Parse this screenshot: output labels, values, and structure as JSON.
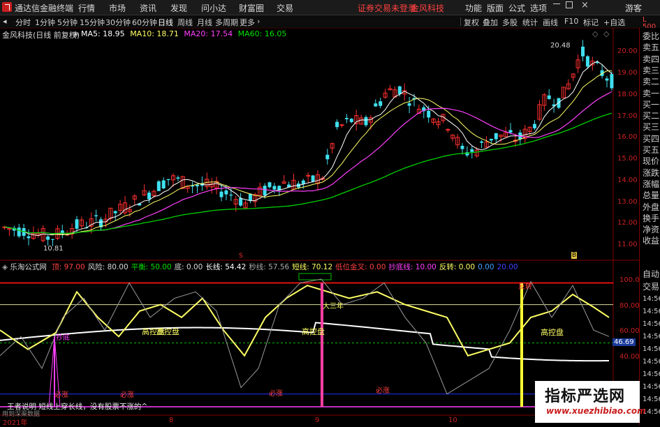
{
  "titlebar": {
    "app_name": "通达信金融终端",
    "menu": [
      "行情",
      "市场",
      "资讯",
      "发现",
      "问小达",
      "财富圈",
      "交易"
    ],
    "notice": "证券交易未登录",
    "stock_name_top": "金风科技",
    "right_menu": [
      "功能",
      "版面",
      "公式",
      "选项"
    ],
    "guest": "游客"
  },
  "toolbar": {
    "periods": [
      "分时",
      "1分钟",
      "5分钟",
      "15分钟",
      "30分钟",
      "60分钟",
      "日线",
      "周线",
      "月线",
      "多周期",
      "更多"
    ],
    "active_period": "日线",
    "right_tools": [
      "复权",
      "叠加",
      "多股",
      "统计",
      "画线",
      "F10",
      "标记",
      "+自选"
    ]
  },
  "main_chart": {
    "stock_label": "金风科技(日线 前复权)",
    "ma_labels": [
      {
        "text": "MA5: 18.95",
        "color": "#ffffff"
      },
      {
        "text": "MA10: 18.71",
        "color": "#ffff66"
      },
      {
        "text": "MA20: 17.54",
        "color": "#ff40ff"
      },
      {
        "text": "MA60: 16.05",
        "color": "#00e000"
      }
    ],
    "price_axis": [
      "20.00",
      "19.00",
      "18.00",
      "17.00",
      "16.00",
      "15.00",
      "14.00",
      "13.00",
      "12.00",
      "11.00"
    ],
    "high_label": "20.48",
    "low_label": "10.81",
    "marker_s": "S",
    "marker_b": "B",
    "corner_label": "L 500"
  },
  "indicator": {
    "name": "乐淘公式网",
    "values": [
      {
        "text": "顶: 97.00",
        "color": "#ff4040"
      },
      {
        "text": "风险: 80.00",
        "color": "#d8d8d8"
      },
      {
        "text": "平衡: 50.00",
        "color": "#00e000"
      },
      {
        "text": "底: 0.00",
        "color": "#d8d8d8"
      },
      {
        "text": "长线: 54.42",
        "color": "#ffffff"
      },
      {
        "text": "秒线: 57.56",
        "color": "#aaaaaa"
      },
      {
        "text": "短线: 70.12",
        "color": "#ffff66"
      },
      {
        "text": "低位金叉: 0.00",
        "color": "#ff4040"
      },
      {
        "text": "抄底线: 10.00",
        "color": "#ff40ff"
      },
      {
        "text": "反转: 0.00",
        "color": "#ffff66"
      },
      {
        "text": "0.00",
        "color": "#40a0ff"
      },
      {
        "text": "20.00",
        "color": "#4040ff"
      }
    ],
    "axis": [
      "100.0",
      "80.00",
      "60.00",
      "40.00"
    ],
    "current_value": "46.69",
    "annotations": {
      "gaokong1": "高控盘",
      "gaokong2": "高控盘",
      "gaokong3": "高控盘",
      "gaokong4": "高控盘",
      "dasan": "大三年",
      "kanzhang1": "必涨",
      "kanzhang2": "必涨",
      "kanzhang3": "必涨",
      "kanzhang4": "必涨",
      "fanzhuan": "反转",
      "chaodi": "抄底",
      "bottom_note": "王者说明 短线上穿长线，没有股票不涨的^",
      "bottom_note2": "用到深渠数据"
    }
  },
  "date_axis": [
    "2021年",
    "8",
    "9",
    "10"
  ],
  "side_panel": {
    "top": [
      "委比",
      "卖五",
      "卖四",
      "卖三",
      "卖二",
      "卖一",
      "买一",
      "买二",
      "买三",
      "买四",
      "买五",
      "现价",
      "涨跌",
      "涨幅",
      "总量",
      "外盘",
      "换手",
      "净资",
      "收益"
    ],
    "bottom": [
      "自动",
      "交易",
      "14:56",
      "14:56",
      "14:56",
      "14:56",
      "14:56",
      "14:56",
      "14:56",
      "14:56",
      "14:56",
      "14:56"
    ]
  },
  "watermark": {
    "title": "指标严选网",
    "url": "www.xuezhibiao.com"
  }
}
